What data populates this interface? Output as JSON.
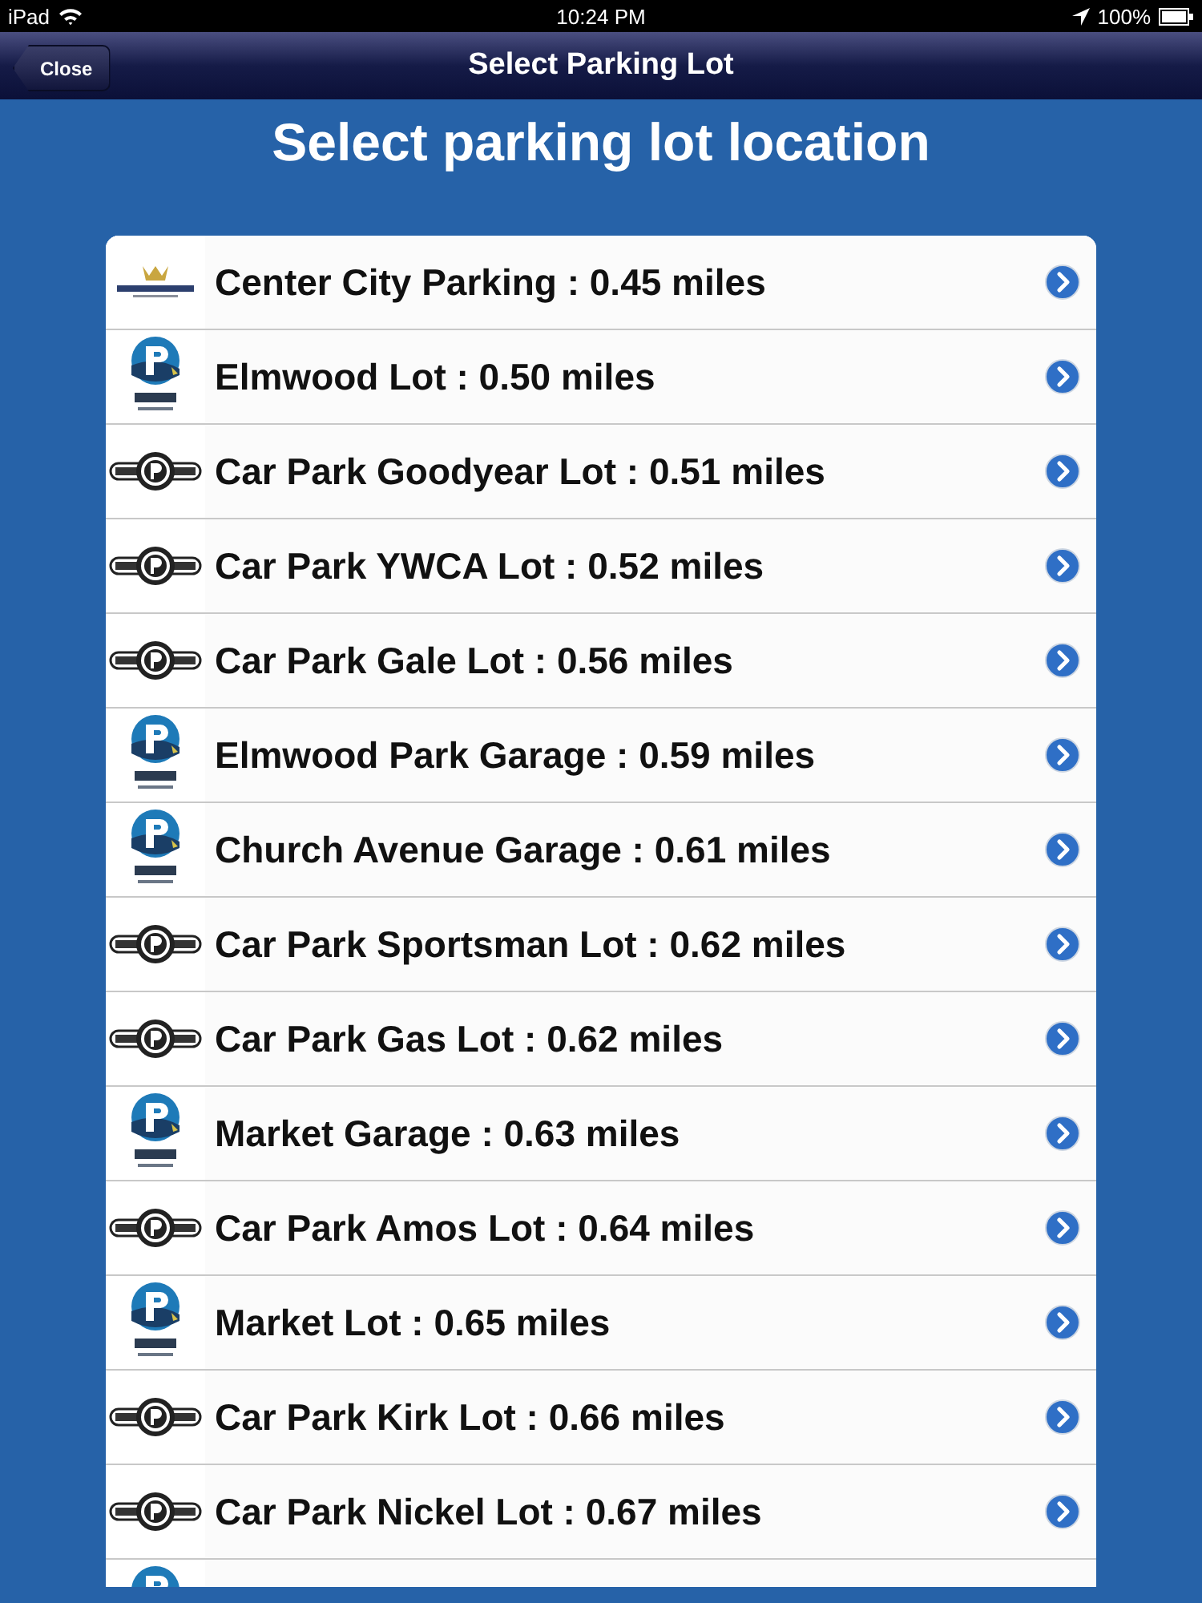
{
  "status_bar": {
    "device": "iPad",
    "time": "10:24 PM",
    "battery": "100%"
  },
  "nav_bar": {
    "back_button": "Close",
    "title": "Select Parking Lot"
  },
  "heading": "Select parking lot location",
  "lots": [
    {
      "kind": "crown",
      "label": "Center City Parking : 0.45 miles"
    },
    {
      "kind": "pcircle",
      "label": "Elmwood Lot : 0.50 miles"
    },
    {
      "kind": "badge",
      "label": "Car Park Goodyear Lot : 0.51 miles"
    },
    {
      "kind": "badge",
      "label": "Car Park YWCA Lot : 0.52 miles"
    },
    {
      "kind": "badge",
      "label": "Car Park Gale Lot : 0.56 miles"
    },
    {
      "kind": "pcircle",
      "label": "Elmwood Park Garage : 0.59 miles"
    },
    {
      "kind": "pcircle",
      "label": "Church Avenue Garage : 0.61 miles"
    },
    {
      "kind": "badge",
      "label": "Car Park Sportsman Lot : 0.62 miles"
    },
    {
      "kind": "badge",
      "label": "Car Park Gas Lot : 0.62 miles"
    },
    {
      "kind": "pcircle",
      "label": "Market Garage : 0.63 miles"
    },
    {
      "kind": "badge",
      "label": "Car Park Amos Lot : 0.64 miles"
    },
    {
      "kind": "pcircle",
      "label": "Market Lot : 0.65 miles"
    },
    {
      "kind": "badge",
      "label": "Car Park Kirk Lot : 0.66 miles"
    },
    {
      "kind": "badge",
      "label": "Car Park Nickel Lot : 0.67 miles"
    },
    {
      "kind": "pcircle"
    }
  ]
}
